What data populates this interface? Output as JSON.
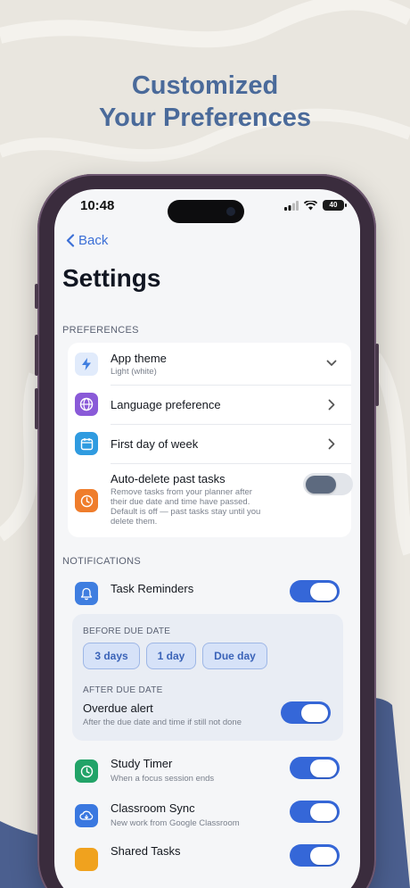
{
  "headline": {
    "line1": "Customized",
    "line2": "Your Preferences"
  },
  "status": {
    "time": "10:48",
    "battery": "40"
  },
  "nav": {
    "back_label": "Back"
  },
  "page": {
    "title": "Settings"
  },
  "preferences": {
    "section_label": "PREFERENCES",
    "app_theme": {
      "title": "App theme",
      "subtitle": "Light (white)"
    },
    "language": {
      "title": "Language preference"
    },
    "first_day": {
      "title": "First day of week"
    },
    "auto_delete": {
      "title": "Auto-delete past tasks",
      "desc1": "Remove tasks from your planner after",
      "desc2": "their due date and time have passed.",
      "desc3": "Default is off — past tasks stay until you",
      "desc4": "delete them.",
      "enabled": false
    }
  },
  "notifications": {
    "section_label": "NOTIFICATIONS",
    "task_reminders": {
      "title": "Task Reminders",
      "enabled": true
    },
    "before_due": {
      "label": "BEFORE DUE DATE",
      "chips": [
        "3 days",
        "1 day",
        "Due day"
      ]
    },
    "after_due": {
      "label": "AFTER DUE DATE",
      "overdue_title": "Overdue alert",
      "overdue_sub": "After the due date and time if still not done",
      "enabled": true
    },
    "study_timer": {
      "title": "Study Timer",
      "subtitle": "When a focus session ends",
      "enabled": true
    },
    "classroom_sync": {
      "title": "Classroom Sync",
      "subtitle": "New work from Google Classroom",
      "enabled": true
    },
    "shared_tasks": {
      "title": "Shared Tasks",
      "enabled": true
    }
  },
  "colors": {
    "accent": "#3567d8",
    "headline": "#4a6a9a",
    "icon_theme_bg": "#e1ebfb",
    "icon_language_bg": "#8a5ad8",
    "icon_calendar_bg": "#2f9be0",
    "icon_clock_bg": "#ef7d2c",
    "icon_bell_bg": "#3f7ee0",
    "icon_timer_bg": "#22a368",
    "icon_sync_bg": "#3a78e0",
    "icon_shared_bg": "#f0a21e"
  },
  "icons": [
    "bolt-icon",
    "globe-icon",
    "calendar-icon",
    "clock-icon",
    "bell-icon",
    "timer-icon",
    "cloud-sync-icon",
    "chevron-down-icon",
    "chevron-right-icon",
    "chevron-left-icon"
  ]
}
